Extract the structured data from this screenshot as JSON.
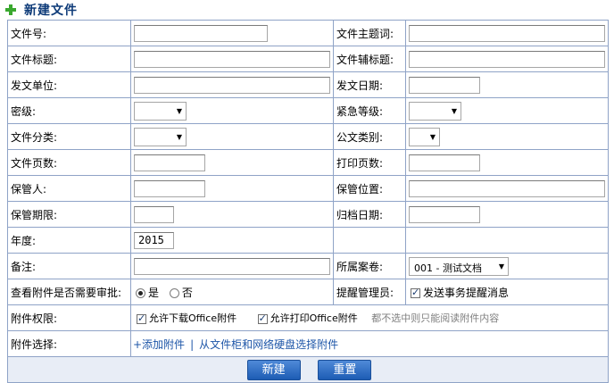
{
  "page": {
    "title": "新建文件"
  },
  "colors": {
    "border": "#8fa3c7",
    "title": "#0d3a78",
    "link": "#1e56a8",
    "button": "#2b6ac4"
  },
  "icons": {
    "title": "plus-icon",
    "dropdown": "chevron-down-icon"
  },
  "fields": {
    "file_no": {
      "label": "文件号:",
      "value": ""
    },
    "subject_words": {
      "label": "文件主题词:",
      "value": ""
    },
    "file_title": {
      "label": "文件标题:",
      "value": ""
    },
    "sub_title": {
      "label": "文件辅标题:",
      "value": ""
    },
    "issuer": {
      "label": "发文单位:",
      "value": ""
    },
    "issue_date": {
      "label": "发文日期:",
      "value": ""
    },
    "secret_level": {
      "label": "密级:",
      "value": ""
    },
    "urgency": {
      "label": "紧急等级:",
      "value": ""
    },
    "category": {
      "label": "文件分类:",
      "value": ""
    },
    "doc_type": {
      "label": "公文类别:",
      "value": ""
    },
    "page_count": {
      "label": "文件页数:",
      "value": ""
    },
    "print_pages": {
      "label": "打印页数:",
      "value": ""
    },
    "keeper": {
      "label": "保管人:",
      "value": ""
    },
    "keep_location": {
      "label": "保管位置:",
      "value": ""
    },
    "keep_period": {
      "label": "保管期限:",
      "value": ""
    },
    "archive_date": {
      "label": "归档日期:",
      "value": ""
    },
    "year": {
      "label": "年度:",
      "value": "2015"
    },
    "remark": {
      "label": "备注:",
      "value": ""
    },
    "volume": {
      "label": "所属案卷:",
      "value": "001 - 测试文档"
    },
    "attach_approval": {
      "label": "查看附件是否需要审批:",
      "yes": "是",
      "no": "否",
      "selected": "是"
    },
    "remind_admin": {
      "label": "提醒管理员:",
      "checkbox_label": "发送事务提醒消息",
      "checked": true
    },
    "attach_perm": {
      "label": "附件权限:",
      "allow_download": "允许下载Office附件",
      "allow_print": "允许打印Office附件",
      "hint": "都不选中则只能阅读附件内容"
    },
    "attach_select": {
      "label": "附件选择:",
      "add_link": "+添加附件",
      "separator": "|",
      "cabinet_link": "从文件柜和网络硬盘选择附件"
    }
  },
  "buttons": {
    "create": "新建",
    "reset": "重置"
  }
}
